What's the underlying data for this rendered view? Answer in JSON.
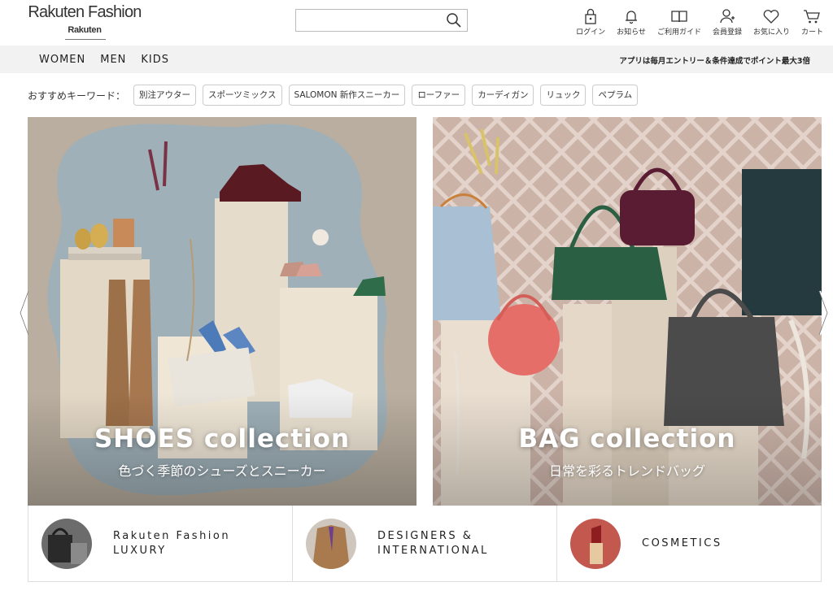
{
  "header": {
    "logo_main": "Rakuten Fashion",
    "logo_sub": "Rakuten",
    "search_placeholder": "",
    "icons": [
      {
        "name": "login-icon",
        "label": "ログイン"
      },
      {
        "name": "bell-icon",
        "label": "お知らせ"
      },
      {
        "name": "guide-book-icon",
        "label": "ご利用ガイド"
      },
      {
        "name": "member-register-icon",
        "label": "会員登録"
      },
      {
        "name": "heart-icon",
        "label": "お気に入り"
      },
      {
        "name": "cart-icon",
        "label": "カート"
      }
    ]
  },
  "nav": {
    "links": [
      "WOMEN",
      "MEN",
      "KIDS"
    ],
    "promo": "アプリは毎月エントリー＆条件達成でポイント最大3倍"
  },
  "keywords": {
    "label": "おすすめキーワード：",
    "items": [
      "別注アウター",
      "スポーツミックス",
      "SALOMON 新作スニーカー",
      "ローファー",
      "カーディガン",
      "リュック",
      "ペプラム"
    ]
  },
  "banners": [
    {
      "title": "SHOES collection",
      "subtitle": "色づく季節のシューズとスニーカー"
    },
    {
      "title": "BAG collection",
      "subtitle": "日常を彩るトレンドバッグ"
    }
  ],
  "categories": [
    {
      "label": "Rakuten Fashion\nLUXURY"
    },
    {
      "label": "DESIGNERS &\nINTERNATIONAL"
    },
    {
      "label": "COSMETICS"
    }
  ],
  "colors": {
    "navbar_bg": "#f2f2f2",
    "text": "#222222",
    "border": "#dddddd"
  }
}
